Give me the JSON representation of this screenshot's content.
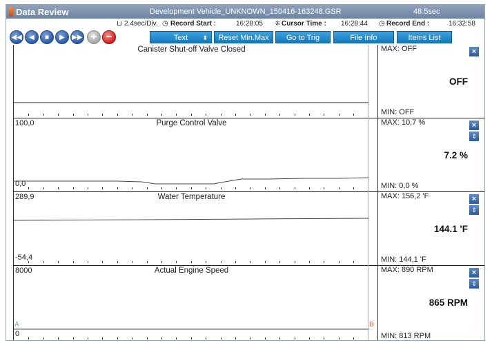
{
  "title_bar": {
    "app_title": "Data Review",
    "file_name": "Development Vehicle_UNKNOWN_150416-163248.GSR",
    "duration": "48.5sec"
  },
  "info": {
    "div": "2.4sec/Div.",
    "record_start_label": "Record Start :",
    "record_start": "16:28:05",
    "cursor_time_label": "Cursor Time :",
    "cursor_time": "16:28:44",
    "record_end_label": "Record End :",
    "record_end": "16:32:58"
  },
  "toolbar": {
    "first_icon": "fast-rewind-icon",
    "prev_icon": "step-back-icon",
    "stop_icon": "stop-icon",
    "next_icon": "step-forward-icon",
    "last_icon": "fast-forward-icon",
    "plus": "+",
    "minus": "−",
    "text_select": "Text",
    "reset_minmax": "Reset Min.Max",
    "go_to_trig": "Go to Trig",
    "file_info": "File Info",
    "items_list": "Items List"
  },
  "cursor": {
    "a": "A",
    "b": "B"
  },
  "panels": [
    {
      "title": "Canister Shut-off Valve Closed",
      "ymax": "",
      "ymin": "",
      "max": "MAX: OFF",
      "min": "MIN: OFF",
      "value": "OFF",
      "close": "×",
      "scale": ""
    },
    {
      "title": "Purge Control Valve",
      "ymax": "100,0",
      "ymin": "0,0",
      "max": "MAX:  10,7 %",
      "min": "MIN:  0,0 %",
      "value": "7.2 %",
      "close": "×",
      "scale": "⇕"
    },
    {
      "title": "Water Temperature",
      "ymax": "289,9",
      "ymin": "-54,4",
      "max": "MAX: 156,2 'F",
      "min": "MIN: 144,1 'F",
      "value": "144.1 'F",
      "close": "×",
      "scale": "⇕"
    },
    {
      "title": "Actual Engine Speed",
      "ymax": "8000",
      "ymin": "0",
      "max": "MAX:   890 RPM",
      "min": "MIN:  813 RPM",
      "value": "865 RPM",
      "close": "×",
      "scale": "⇕"
    }
  ],
  "colors": {
    "toolbar_button": "#1f86cc",
    "title_bar": "#7d91ab",
    "cursor": "#e8a070"
  }
}
